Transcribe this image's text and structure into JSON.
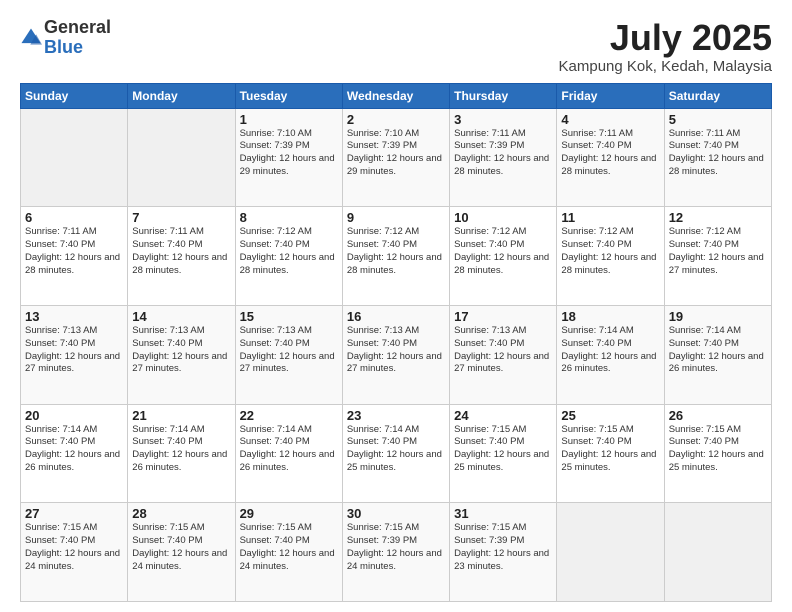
{
  "logo": {
    "general": "General",
    "blue": "Blue"
  },
  "header": {
    "month": "July 2025",
    "location": "Kampung Kok, Kedah, Malaysia"
  },
  "days_of_week": [
    "Sunday",
    "Monday",
    "Tuesday",
    "Wednesday",
    "Thursday",
    "Friday",
    "Saturday"
  ],
  "weeks": [
    [
      {
        "day": "",
        "info": ""
      },
      {
        "day": "",
        "info": ""
      },
      {
        "day": "1",
        "info": "Sunrise: 7:10 AM\nSunset: 7:39 PM\nDaylight: 12 hours and 29 minutes."
      },
      {
        "day": "2",
        "info": "Sunrise: 7:10 AM\nSunset: 7:39 PM\nDaylight: 12 hours and 29 minutes."
      },
      {
        "day": "3",
        "info": "Sunrise: 7:11 AM\nSunset: 7:39 PM\nDaylight: 12 hours and 28 minutes."
      },
      {
        "day": "4",
        "info": "Sunrise: 7:11 AM\nSunset: 7:40 PM\nDaylight: 12 hours and 28 minutes."
      },
      {
        "day": "5",
        "info": "Sunrise: 7:11 AM\nSunset: 7:40 PM\nDaylight: 12 hours and 28 minutes."
      }
    ],
    [
      {
        "day": "6",
        "info": "Sunrise: 7:11 AM\nSunset: 7:40 PM\nDaylight: 12 hours and 28 minutes."
      },
      {
        "day": "7",
        "info": "Sunrise: 7:11 AM\nSunset: 7:40 PM\nDaylight: 12 hours and 28 minutes."
      },
      {
        "day": "8",
        "info": "Sunrise: 7:12 AM\nSunset: 7:40 PM\nDaylight: 12 hours and 28 minutes."
      },
      {
        "day": "9",
        "info": "Sunrise: 7:12 AM\nSunset: 7:40 PM\nDaylight: 12 hours and 28 minutes."
      },
      {
        "day": "10",
        "info": "Sunrise: 7:12 AM\nSunset: 7:40 PM\nDaylight: 12 hours and 28 minutes."
      },
      {
        "day": "11",
        "info": "Sunrise: 7:12 AM\nSunset: 7:40 PM\nDaylight: 12 hours and 28 minutes."
      },
      {
        "day": "12",
        "info": "Sunrise: 7:12 AM\nSunset: 7:40 PM\nDaylight: 12 hours and 27 minutes."
      }
    ],
    [
      {
        "day": "13",
        "info": "Sunrise: 7:13 AM\nSunset: 7:40 PM\nDaylight: 12 hours and 27 minutes."
      },
      {
        "day": "14",
        "info": "Sunrise: 7:13 AM\nSunset: 7:40 PM\nDaylight: 12 hours and 27 minutes."
      },
      {
        "day": "15",
        "info": "Sunrise: 7:13 AM\nSunset: 7:40 PM\nDaylight: 12 hours and 27 minutes."
      },
      {
        "day": "16",
        "info": "Sunrise: 7:13 AM\nSunset: 7:40 PM\nDaylight: 12 hours and 27 minutes."
      },
      {
        "day": "17",
        "info": "Sunrise: 7:13 AM\nSunset: 7:40 PM\nDaylight: 12 hours and 27 minutes."
      },
      {
        "day": "18",
        "info": "Sunrise: 7:14 AM\nSunset: 7:40 PM\nDaylight: 12 hours and 26 minutes."
      },
      {
        "day": "19",
        "info": "Sunrise: 7:14 AM\nSunset: 7:40 PM\nDaylight: 12 hours and 26 minutes."
      }
    ],
    [
      {
        "day": "20",
        "info": "Sunrise: 7:14 AM\nSunset: 7:40 PM\nDaylight: 12 hours and 26 minutes."
      },
      {
        "day": "21",
        "info": "Sunrise: 7:14 AM\nSunset: 7:40 PM\nDaylight: 12 hours and 26 minutes."
      },
      {
        "day": "22",
        "info": "Sunrise: 7:14 AM\nSunset: 7:40 PM\nDaylight: 12 hours and 26 minutes."
      },
      {
        "day": "23",
        "info": "Sunrise: 7:14 AM\nSunset: 7:40 PM\nDaylight: 12 hours and 25 minutes."
      },
      {
        "day": "24",
        "info": "Sunrise: 7:15 AM\nSunset: 7:40 PM\nDaylight: 12 hours and 25 minutes."
      },
      {
        "day": "25",
        "info": "Sunrise: 7:15 AM\nSunset: 7:40 PM\nDaylight: 12 hours and 25 minutes."
      },
      {
        "day": "26",
        "info": "Sunrise: 7:15 AM\nSunset: 7:40 PM\nDaylight: 12 hours and 25 minutes."
      }
    ],
    [
      {
        "day": "27",
        "info": "Sunrise: 7:15 AM\nSunset: 7:40 PM\nDaylight: 12 hours and 24 minutes."
      },
      {
        "day": "28",
        "info": "Sunrise: 7:15 AM\nSunset: 7:40 PM\nDaylight: 12 hours and 24 minutes."
      },
      {
        "day": "29",
        "info": "Sunrise: 7:15 AM\nSunset: 7:40 PM\nDaylight: 12 hours and 24 minutes."
      },
      {
        "day": "30",
        "info": "Sunrise: 7:15 AM\nSunset: 7:39 PM\nDaylight: 12 hours and 24 minutes."
      },
      {
        "day": "31",
        "info": "Sunrise: 7:15 AM\nSunset: 7:39 PM\nDaylight: 12 hours and 23 minutes."
      },
      {
        "day": "",
        "info": ""
      },
      {
        "day": "",
        "info": ""
      }
    ]
  ]
}
